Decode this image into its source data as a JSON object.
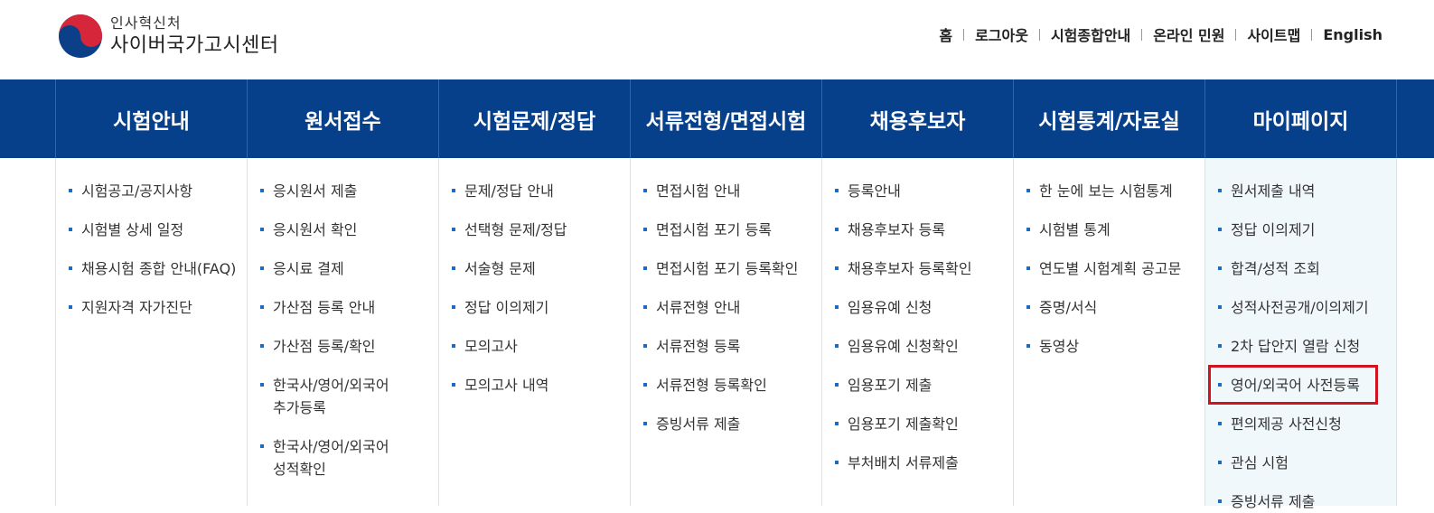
{
  "header": {
    "logo_sub": "인사혁신처",
    "logo_main": "사이버국가고시센터",
    "util_links": [
      "홈",
      "로그아웃",
      "시험종합안내",
      "온라인 민원",
      "사이트맵",
      "English"
    ]
  },
  "nav": {
    "tabs": [
      "시험안내",
      "원서접수",
      "시험문제/정답",
      "서류전형/면접시험",
      "채용후보자",
      "시험통계/자료실",
      "마이페이지"
    ]
  },
  "menu": {
    "columns": [
      {
        "items": [
          "시험공고/공지사항",
          "시험별 상세 일정",
          "채용시험 종합 안내(FAQ)",
          "지원자격 자가진단"
        ]
      },
      {
        "items": [
          "응시원서 제출",
          "응시원서 확인",
          "응시료 결제",
          "가산점 등록 안내",
          "가산점 등록/확인",
          "한국사/영어/외국어\n추가등록",
          "한국사/영어/외국어\n성적확인"
        ]
      },
      {
        "items": [
          "문제/정답 안내",
          "선택형 문제/정답",
          "서술형 문제",
          "정답 이의제기",
          "모의고사",
          "모의고사 내역"
        ]
      },
      {
        "items": [
          "면접시험 안내",
          "면접시험 포기 등록",
          "면접시험 포기 등록확인",
          "서류전형 안내",
          "서류전형 등록",
          "서류전형 등록확인",
          "증빙서류 제출"
        ]
      },
      {
        "items": [
          "등록안내",
          "채용후보자 등록",
          "채용후보자 등록확인",
          "임용유예 신청",
          "임용유예 신청확인",
          "임용포기 제출",
          "임용포기 제출확인",
          "부처배치 서류제출"
        ]
      },
      {
        "items": [
          "한 눈에 보는 시험통계",
          "시험별 통계",
          "연도별 시험계획 공고문",
          "증명/서식",
          "동영상"
        ]
      },
      {
        "items": [
          "원서제출 내역",
          "정답 이의제기",
          "합격/성적 조회",
          "성적사전공개/이의제기",
          "2차 답안지 열람 신청",
          "영어/외국어 사전등록",
          "편의제공 사전신청",
          "관심 시험",
          "증빙서류 제출"
        ]
      }
    ]
  },
  "colors": {
    "nav_bg": "#06408a",
    "bullet": "#1e6ac2",
    "highlight_bg": "#f1f8fc",
    "annotation_box": "#d0131f"
  }
}
